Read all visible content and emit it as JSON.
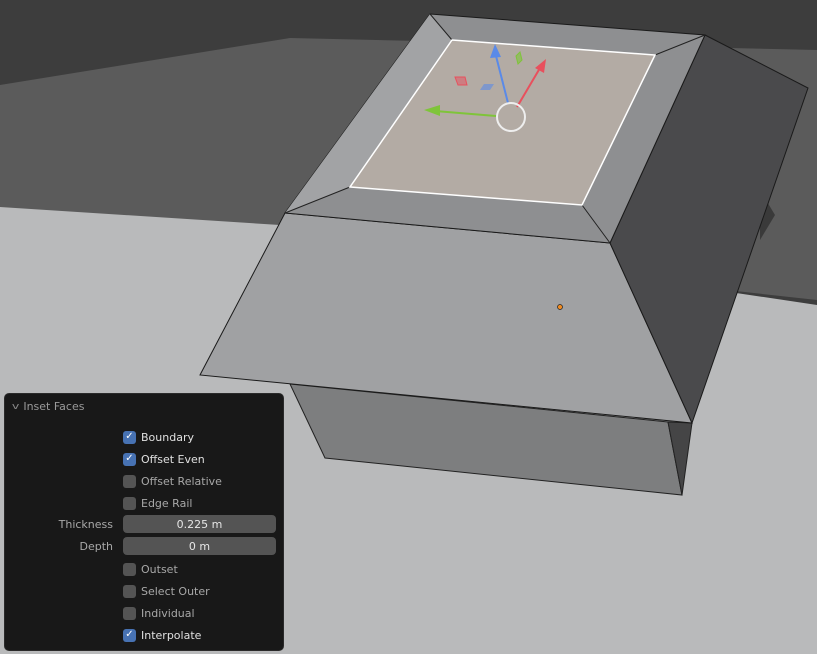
{
  "panel": {
    "title": "Inset Faces",
    "options": [
      {
        "label": "Boundary",
        "checked": true
      },
      {
        "label": "Offset Even",
        "checked": true
      },
      {
        "label": "Offset Relative",
        "checked": false
      },
      {
        "label": "Edge Rail",
        "checked": false
      }
    ],
    "thickness": {
      "label": "Thickness",
      "value": "0.225 m"
    },
    "depth": {
      "label": "Depth",
      "value": "0 m"
    },
    "options2": [
      {
        "label": "Outset",
        "checked": false
      },
      {
        "label": "Select Outer",
        "checked": false
      },
      {
        "label": "Individual",
        "checked": false
      },
      {
        "label": "Interpolate",
        "checked": true
      }
    ]
  },
  "colors": {
    "checkbox_on": "#4772b3",
    "selected_face": "#b3aba4",
    "gizmo_x": "#e8505d",
    "gizmo_y": "#7fc43a",
    "gizmo_z": "#5a8ae8",
    "origin": "#f08a20"
  }
}
